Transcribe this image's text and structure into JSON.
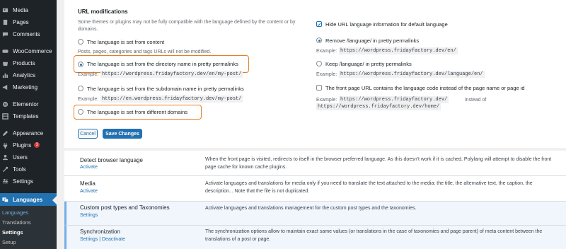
{
  "sidebar": {
    "items": [
      {
        "label": "Media",
        "icon": "media-icon"
      },
      {
        "label": "Pages",
        "icon": "pages-icon"
      },
      {
        "label": "Comments",
        "icon": "comments-icon"
      },
      {
        "label": "WooCommerce",
        "icon": "woocommerce-icon"
      },
      {
        "label": "Products",
        "icon": "products-icon"
      },
      {
        "label": "Analytics",
        "icon": "analytics-icon"
      },
      {
        "label": "Marketing",
        "icon": "marketing-icon"
      },
      {
        "label": "Elementor",
        "icon": "elementor-icon"
      },
      {
        "label": "Templates",
        "icon": "templates-icon"
      },
      {
        "label": "Appearance",
        "icon": "appearance-icon"
      },
      {
        "label": "Plugins",
        "icon": "plugins-icon",
        "badge": "3"
      },
      {
        "label": "Users",
        "icon": "users-icon"
      },
      {
        "label": "Tools",
        "icon": "tools-icon"
      },
      {
        "label": "Settings",
        "icon": "settings-icon"
      },
      {
        "label": "Languages",
        "icon": "languages-icon"
      }
    ],
    "submenu": [
      "Languages",
      "Translations",
      "Settings",
      "Setup"
    ],
    "colors": {
      "bg": "#1d2327",
      "active": "#2271b1",
      "badge": "#d63638"
    }
  },
  "url_mod": {
    "title": "URL modifications",
    "note": "Some themes or plugins may not be fully compatible with the language defined by the content or by domains.",
    "options": [
      {
        "label": "The language is set from content",
        "checked": false
      },
      {
        "label": "The language is set from the directory name in pretty permalinks",
        "checked": true
      },
      {
        "label": "The language is set from the subdomain name in pretty permalinks",
        "checked": false
      },
      {
        "label": "The language is set from different domains",
        "checked": false
      }
    ],
    "content_note": "Posts, pages, categories and tags URLs will not be modified.",
    "example_label": "Example:",
    "example_directory": "https://wordpress.fridayfactory.dev/en/my-post/",
    "example_subdomain": "https://en.wordpress.fridayfactory.dev/my-post/",
    "hide_default": {
      "label": "Hide URL language information for default language",
      "checked": true
    },
    "permalink_options": [
      {
        "label": "Remove /language/ in pretty permalinks",
        "checked": true,
        "example": "https://wordpress.fridayfactory.dev/en/"
      },
      {
        "label": "Keep /language/ in pretty permalinks",
        "checked": false,
        "example": "https://wordpress.fridayfactory.dev/language/en/"
      }
    ],
    "front_page": {
      "label": "The front page URL contains the language code instead of the page name or page id",
      "checked": false,
      "example_1": "https://wordpress.fridayfactory.dev/",
      "instead_of": "instead of",
      "example_2": "https://wordpress.fridayfactory.dev/home/"
    },
    "cancel_label": "Cancel",
    "save_label": "Save Changes",
    "highlight_color": "#e67e22"
  },
  "modules": [
    {
      "name": "Detect browser language",
      "actions": "Activate",
      "description": "When the front page is visited, redirects to itself in the browser preferred language. As this doesn't work if it is cached, Polylang will attempt to disable the front page cache for known cache plugins."
    },
    {
      "name": "Media",
      "actions": "Activate",
      "description": "Activate languages and translations for media only if you need to translate the text attached to the media: the title, the alternative text, the caption, the description... Note that the file is not duplicated."
    },
    {
      "name": "Custom post types and Taxonomies",
      "actions": "Settings",
      "description": "Activate languages and translations management for the custom post types and the taxonomies."
    },
    {
      "name": "Synchronization",
      "actions": "Settings | Deactivate",
      "description": "The synchronization options allow to maintain exact same values (or translations in the case of taxonomies and page parent) of meta content between the translations of a post or page."
    }
  ]
}
